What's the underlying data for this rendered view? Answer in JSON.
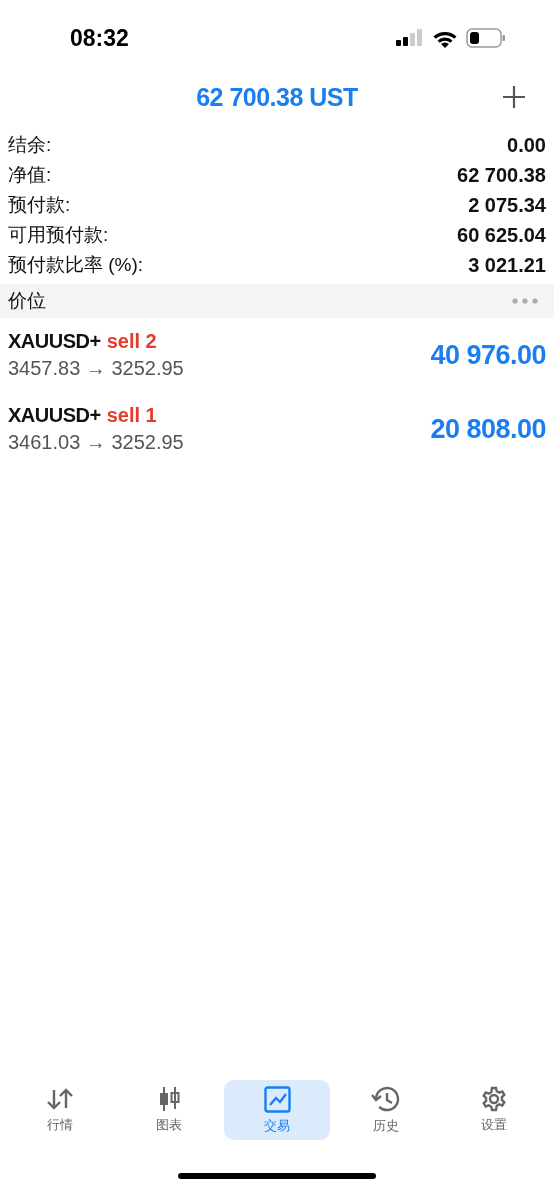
{
  "status_bar": {
    "time": "08:32"
  },
  "header": {
    "title": "62 700.38 UST"
  },
  "summary": [
    {
      "label": "结余:",
      "value": "0.00"
    },
    {
      "label": "净值:",
      "value": "62 700.38"
    },
    {
      "label": "预付款:",
      "value": "2 075.34"
    },
    {
      "label": "可用预付款:",
      "value": "60 625.04"
    },
    {
      "label": "预付款比率 (%):",
      "value": "3 021.21"
    }
  ],
  "section": {
    "title": "价位"
  },
  "positions": [
    {
      "symbol": "XAUUSD+",
      "side": "sell 2",
      "prices": "3457.83 → 3252.95",
      "profit": "40 976.00"
    },
    {
      "symbol": "XAUUSD+",
      "side": "sell 1",
      "prices": "3461.03 → 3252.95",
      "profit": "20 808.00"
    }
  ],
  "tabs": [
    {
      "kind": "quotes",
      "label": "行情",
      "selected": false
    },
    {
      "kind": "chart",
      "label": "图表",
      "selected": false
    },
    {
      "kind": "trade",
      "label": "交易",
      "selected": true
    },
    {
      "kind": "history",
      "label": "历史",
      "selected": false
    },
    {
      "kind": "settings",
      "label": "设置",
      "selected": false
    }
  ]
}
